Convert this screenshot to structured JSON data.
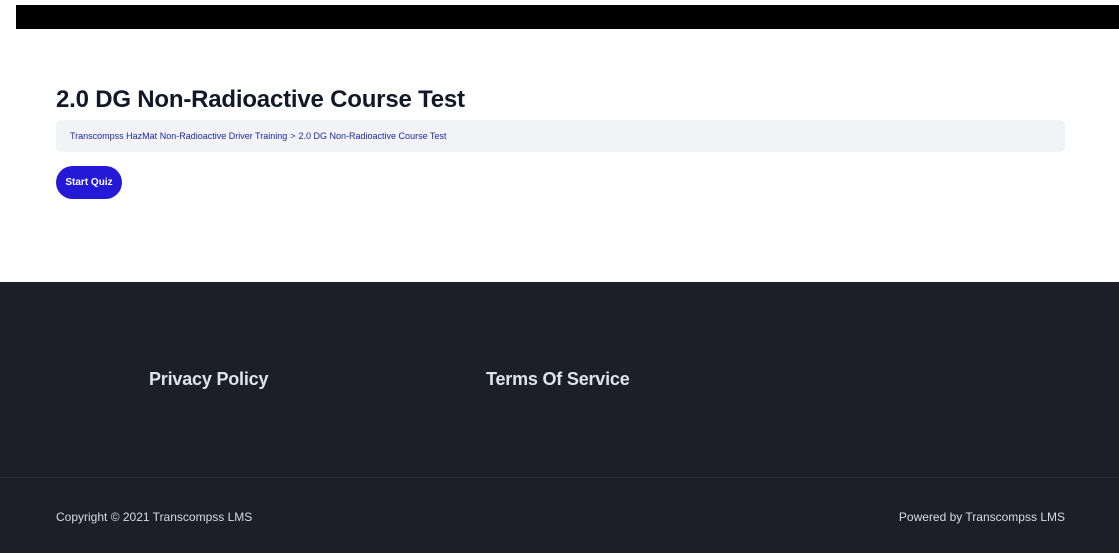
{
  "header": {
    "bar_color": "#000000"
  },
  "main": {
    "title": "2.0 DG Non-Radioactive Course Test",
    "breadcrumb": {
      "items": [
        "Transcompss HazMat Non-Radioactive Driver Training",
        "2.0 DG Non-Radioactive Course Test"
      ],
      "separator": ">"
    },
    "start_quiz_label": "Start Quiz"
  },
  "footer": {
    "links": [
      "Privacy Policy",
      "Terms Of Service"
    ],
    "copyright": "Copyright © 2021 Transcompss LMS",
    "powered_by": "Powered by Transcompss LMS"
  },
  "colors": {
    "accent": "#2319d6",
    "link": "#1f2a9e",
    "footer_bg": "#1c1f2a",
    "breadcrumb_bg": "#f1f3f6"
  }
}
